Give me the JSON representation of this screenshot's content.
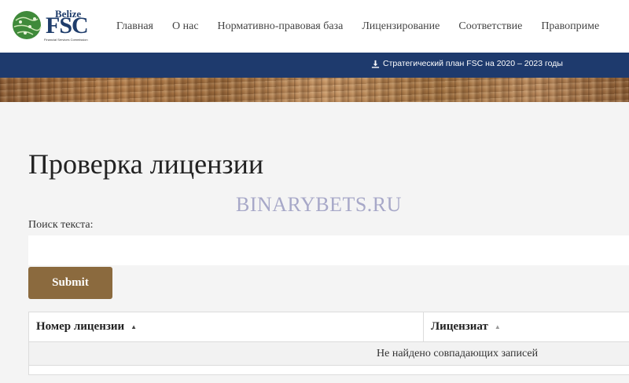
{
  "logo": {
    "top_text": "Belize",
    "main_text": "FSC",
    "subtitle": "Financial Services Commission"
  },
  "nav": {
    "items": [
      {
        "label": "Главная"
      },
      {
        "label": "О нас"
      },
      {
        "label": "Нормативно-правовая база"
      },
      {
        "label": "Лицензирование"
      },
      {
        "label": "Соответствие"
      },
      {
        "label": "Правоприме"
      }
    ]
  },
  "topbar": {
    "download_label": "Стратегический план FSC на 2020 – 2023 годы",
    "icon": "download-icon"
  },
  "page": {
    "title": "Проверка лицензии",
    "watermark": "BINARYBETS.RU"
  },
  "search": {
    "label": "Поиск текста:",
    "value": "",
    "placeholder": ""
  },
  "submit": {
    "label": "Submit"
  },
  "table": {
    "columns": [
      {
        "label": "Номер лицензии"
      },
      {
        "label": "Лицензиат"
      }
    ],
    "empty_message": "Не найдено совпадающих записей",
    "rows": []
  },
  "colors": {
    "brand_navy": "#1e3a6d",
    "button_brown": "#8b6a3e",
    "watermark": "#a7a8c8"
  }
}
